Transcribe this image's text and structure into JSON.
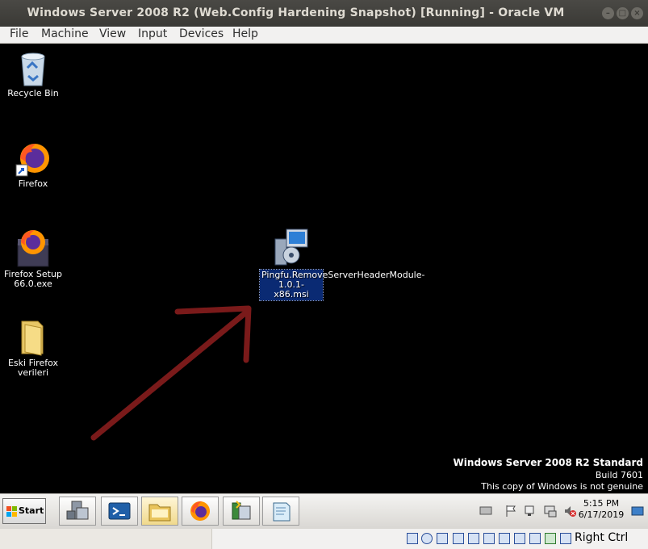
{
  "window": {
    "title": "Windows Server 2008 R2 (Web.Config Hardening Snapshot) [Running] - Oracle VM VirtualBox",
    "buttons": [
      "minimize",
      "maximize",
      "close"
    ]
  },
  "menu": [
    "File",
    "Machine",
    "View",
    "Input",
    "Devices",
    "Help"
  ],
  "desktop": {
    "icons": [
      {
        "label": "Recycle Bin",
        "icon": "recycle-bin-icon"
      },
      {
        "label": "Firefox",
        "icon": "firefox-icon"
      },
      {
        "label": "Firefox Setup 66.0.exe",
        "icon": "firefox-setup-icon"
      },
      {
        "label": "Eski Firefox verileri",
        "icon": "folder-icon"
      },
      {
        "label": "Pingfu.RemoveServerHeaderModule-1.0.1-x86.msi",
        "icon": "msi-installer-icon",
        "selected": true
      }
    ],
    "watermark": {
      "edition": "Windows Server 2008 R2 Standard",
      "build": "Build 7601",
      "genuine": "This copy of Windows is not genuine"
    },
    "annotation": "arrow-pointing-to-msi"
  },
  "taskbar": {
    "start_label": "Start",
    "pinned": [
      "server-manager-icon",
      "powershell-icon",
      "explorer-icon",
      "firefox-icon",
      "installer-icon",
      "notepad-icon"
    ],
    "tray_icons": [
      "keyboard-icon",
      "flag-icon",
      "network-icon",
      "display-icon",
      "volume-muted-icon"
    ],
    "clock_time": "5:15 PM",
    "clock_date": "6/17/2019"
  },
  "statusbar": {
    "host_key": "Right Ctrl",
    "icons": [
      "hard-disk-icon",
      "optical-drive-icon",
      "audio-icon",
      "network-adapter-icon",
      "usb-icon",
      "shared-folder-icon",
      "display-icon",
      "video-capture-icon",
      "cpu-icon",
      "mouse-integration-icon",
      "keyboard-capture-icon"
    ]
  },
  "colors": {
    "titlebar": "#3c3b37",
    "desktop": "#000000",
    "selection": "#0a2a73",
    "arrow": "#7a1a1a"
  }
}
